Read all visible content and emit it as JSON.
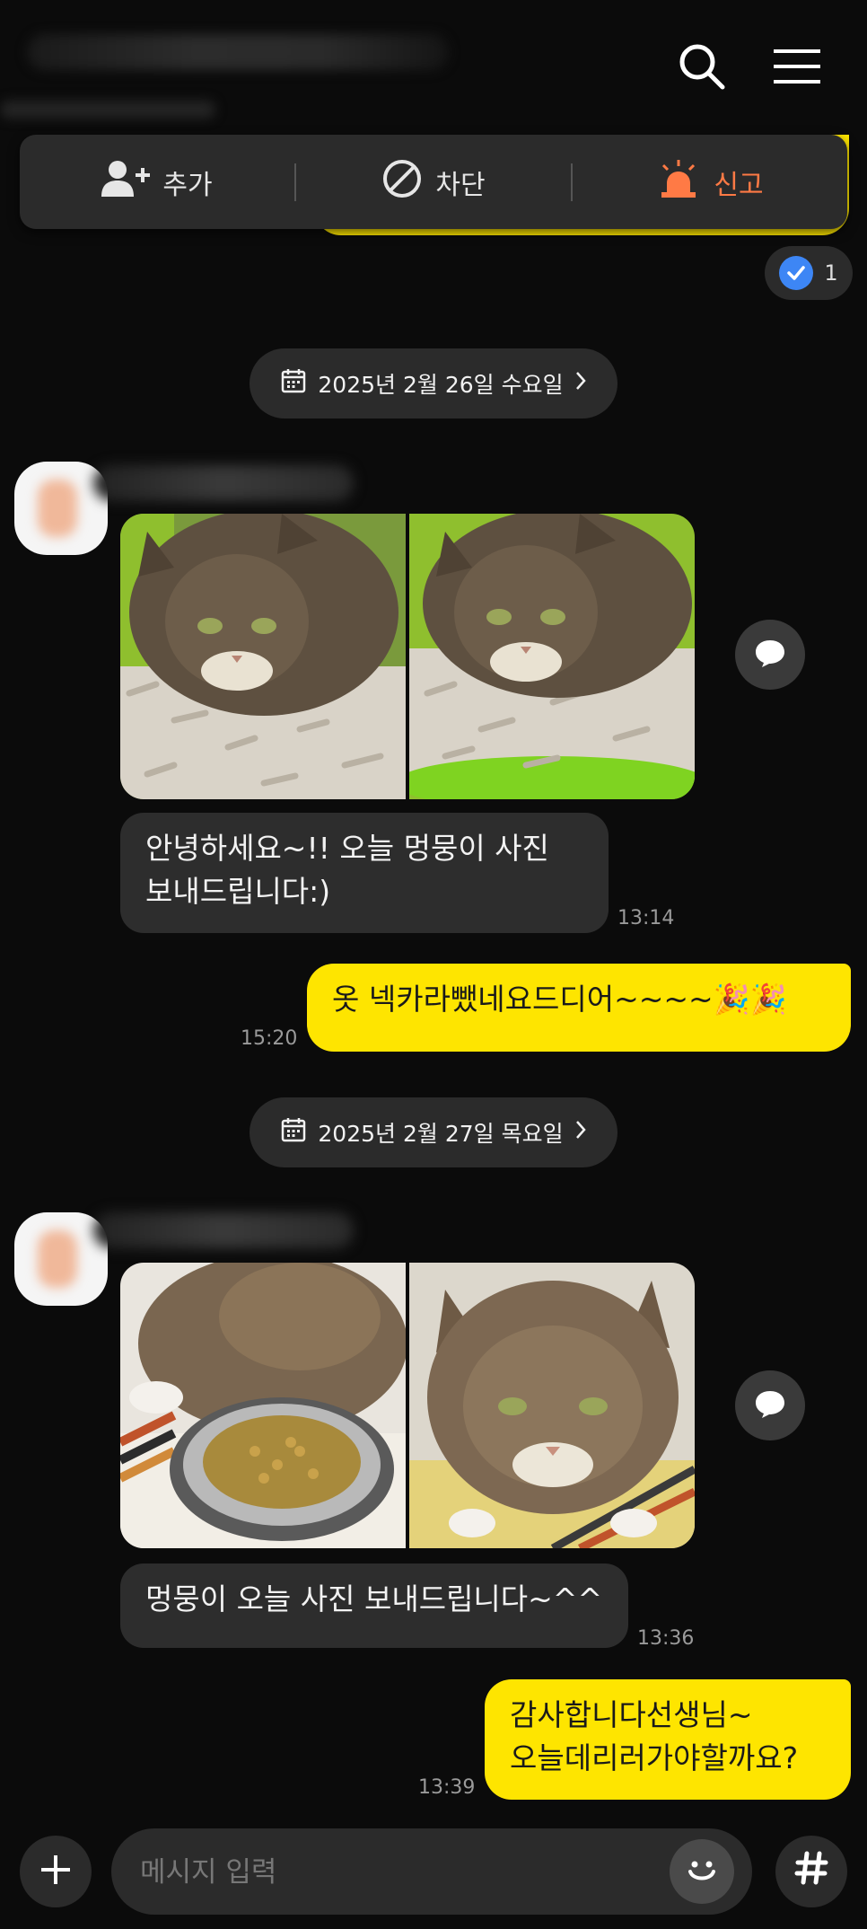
{
  "header": {
    "search_icon": "search-icon",
    "menu_icon": "menu-icon"
  },
  "actions": {
    "add": "추가",
    "block": "차단",
    "report": "신고"
  },
  "read_count": "1",
  "dates": {
    "first": "2025년 2월 26일 수요일",
    "second": "2025년 2월 27일 목요일"
  },
  "messages": {
    "m1_text": "안녕하세요~!! 오늘 멍뭉이 사진\n보내드립니다:)",
    "m1_time": "13:14",
    "m2_text": "옷 넥카라뺐네요드디어~~~~🎉🎉",
    "m2_time": "15:20",
    "m3_text": "멍뭉이 오늘 사진 보내드립니다~^^",
    "m3_time": "13:36",
    "m4_text": "감사합니다선생님~\n오늘데리러가야할까요?",
    "m4_time": "13:39"
  },
  "input": {
    "placeholder": "메시지 입력"
  },
  "colors": {
    "accent_yellow": "#fee500",
    "report_orange": "#ff7a45",
    "bubble_gray": "#2d2d2d",
    "bg": "#0b0b0b"
  }
}
